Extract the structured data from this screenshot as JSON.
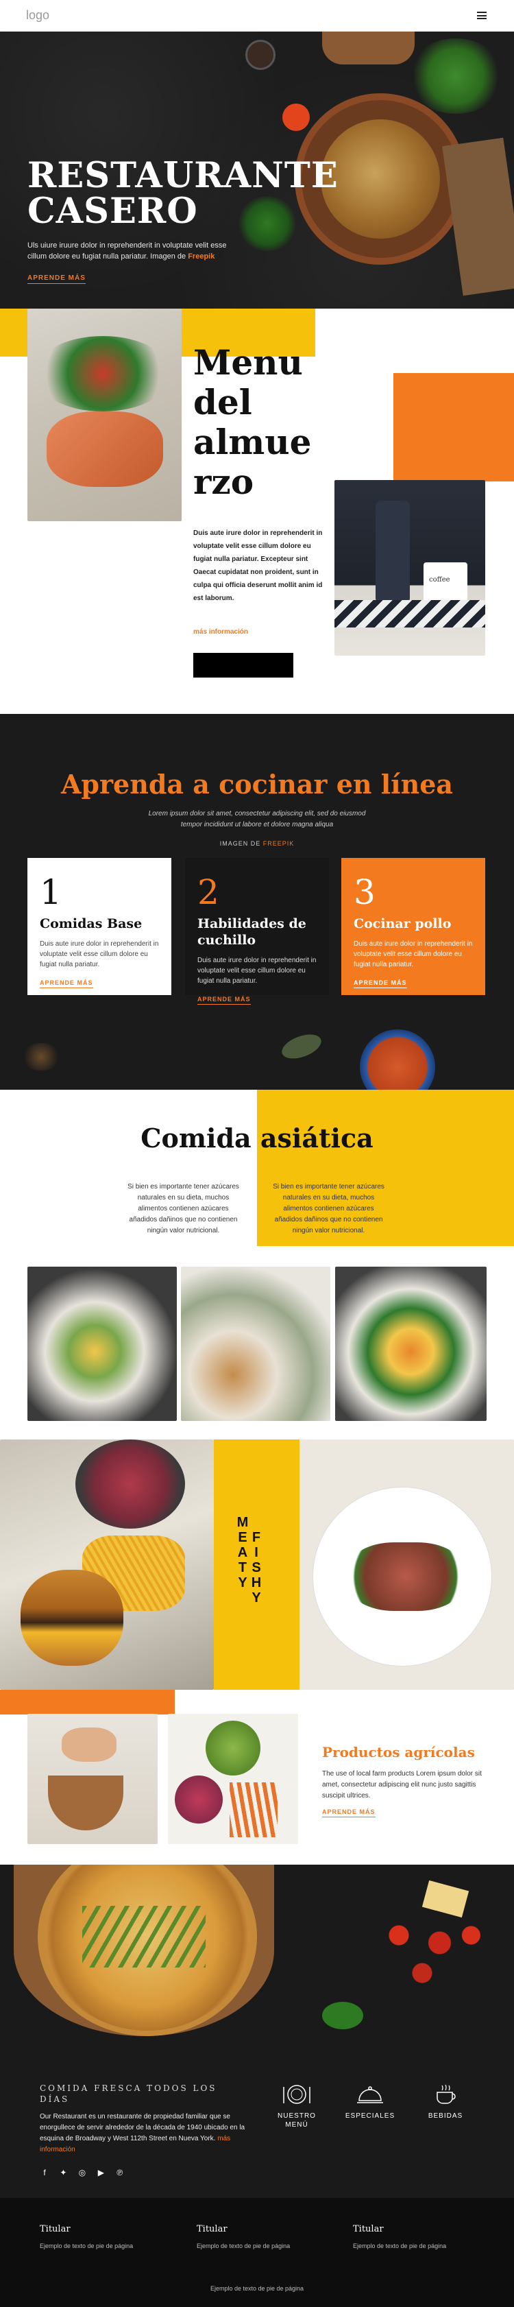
{
  "header": {
    "logo": "logo"
  },
  "hero": {
    "title_line1": "RESTAURANTE",
    "title_line2": "CASERO",
    "text_before": "Uls uiure iruure dolor in reprehenderit in voluptate velit esse cillum dolore eu fugiat nulla pariatur. Imagen de",
    "text_link": "Freepik",
    "cta": "APRENDE MÁS"
  },
  "lunch": {
    "title_lines": [
      "Menu",
      "del",
      "almue",
      "rzo"
    ],
    "body": "Duis aute irure dolor in reprehenderit in voluptate velit esse cillum dolore eu fugiat nulla pariatur. Excepteur sint Oaecat cupidatat non proident, sunt in culpa qui officia deserunt mollit anim id est laborum.",
    "link": "más información",
    "mug_text": "coffee"
  },
  "learn": {
    "title_pre": "Aprenda a",
    "title_bold": "cocinar",
    "title_post": "en línea",
    "subtitle": "Lorem ipsum dolor sit amet, consectetur adipiscing elit, sed do eiusmod tempor incididunt ut labore et dolore magna aliqua",
    "credit_pre": "IMAGEN DE",
    "credit_link": "FREEPIK",
    "cards": [
      {
        "num": "1",
        "title": "Comidas Base",
        "text": "Duis aute irure dolor in reprehenderit in voluptate velit esse cillum dolore eu fugiat nulla pariatur.",
        "link": "APRENDE MÁS"
      },
      {
        "num": "2",
        "title": "Habilidades de cuchillo",
        "text": "Duis aute irure dolor in reprehenderit in voluptate velit esse cillum dolore eu fugiat nulla pariatur.",
        "link": "APRENDE MÁS"
      },
      {
        "num": "3",
        "title": "Cocinar pollo",
        "text": "Duis aute irure dolor in reprehenderit in voluptate velit esse cillum dolore eu fugiat nulla pariatur.",
        "link": "APRENDE MÁS"
      }
    ]
  },
  "asian": {
    "title": "Comida asiática",
    "col1": "Si bien es importante tener azúcares naturales en su dieta, muchos alimentos contienen azúcares añadidos dañinos que no contienen ningún valor nutricional.",
    "col2": "Si bien es importante tener azúcares naturales en su dieta, muchos alimentos contienen azúcares añadidos dañinos que no contienen ningún valor nutricional."
  },
  "meaty": {
    "col1_letters": [
      "M",
      "E",
      "A",
      "T",
      "Y"
    ],
    "col2_letters": [
      "F",
      "I",
      "S",
      "H",
      "Y"
    ]
  },
  "farm": {
    "title": "Productos agrícolas",
    "text": "The use of local farm products Lorem ipsum dolor sit amet, consectetur adipiscing elit nunc justo sagittis suscipit ultrices.",
    "link": "APRENDE MÁS"
  },
  "fresh": {
    "heading": "COMIDA FRESCA TODOS LOS DÍAS",
    "text": "Our Restaurant es un restaurante de propiedad familiar que se enorgullece de servir alrededor de la década de 1940 ubicado en la esquina de Broadway y West 112th Street en Nueva York.",
    "link": "más información",
    "services": [
      {
        "icon": "dinner-plate-icon",
        "label": "NUESTRO MENÚ"
      },
      {
        "icon": "cloche-icon",
        "label": "ESPECIALES"
      },
      {
        "icon": "coffee-cup-icon",
        "label": "BEBIDAS"
      }
    ],
    "social_icons": [
      "facebook-icon",
      "twitter-icon",
      "instagram-icon",
      "youtube-icon",
      "pinterest-icon"
    ]
  },
  "footer": {
    "columns": [
      {
        "title": "Titular",
        "text": "Ejemplo de texto de pie de página"
      },
      {
        "title": "Titular",
        "text": "Ejemplo de texto de pie de página"
      },
      {
        "title": "Titular",
        "text": "Ejemplo de texto de pie de página"
      }
    ],
    "bottom": "Ejemplo de texto de pie de página"
  },
  "colors": {
    "accent_orange": "#f47a1f",
    "accent_yellow": "#f5c10b",
    "dark": "#1b1b1b"
  }
}
